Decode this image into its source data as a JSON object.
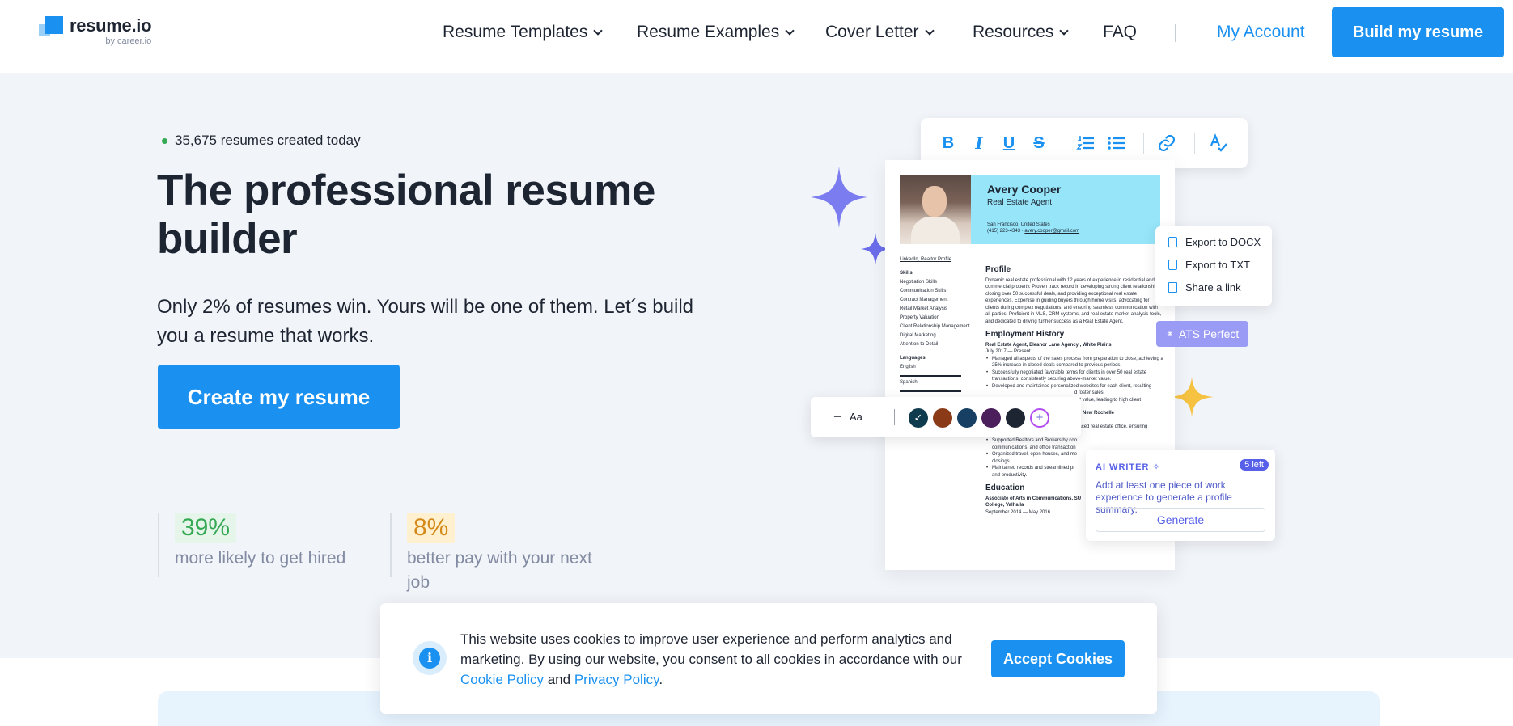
{
  "header": {
    "logo_name": "resume.io",
    "logo_sub": "by career.io",
    "nav": [
      {
        "label": "Resume Templates",
        "has_dropdown": true
      },
      {
        "label": "Resume Examples",
        "has_dropdown": true
      },
      {
        "label": "Cover Letter",
        "has_dropdown": true
      },
      {
        "label": "Resources",
        "has_dropdown": true
      },
      {
        "label": "FAQ",
        "has_dropdown": false
      }
    ],
    "my_account": "My Account",
    "build_button": "Build my resume"
  },
  "hero": {
    "counter": "35,675 resumes created today",
    "title": "The professional resume builder",
    "subtitle": "Only 2% of resumes win. Yours will be one of them. Let´s build you a resume that works.",
    "cta": "Create my resume",
    "stats": [
      {
        "value": "39%",
        "label": "more likely to get hired",
        "color": "#34a853",
        "bg": "#e6f5ea"
      },
      {
        "value": "8%",
        "label": "better pay with your next job",
        "color": "#d48a1a",
        "bg": "#fff1cf"
      }
    ]
  },
  "editor": {
    "toolbar_icons": [
      "bold-icon",
      "italic-icon",
      "underline-icon",
      "strikethrough-icon",
      "numbered-list-icon",
      "bulleted-list-icon",
      "link-icon",
      "spellcheck-icon"
    ],
    "toolbar_glyphs": {
      "bold": "B",
      "italic": "I",
      "underline": "U",
      "strike": "S"
    },
    "resume": {
      "name": "Avery Cooper",
      "role": "Real Estate Agent",
      "location": "San Francisco, United States",
      "phone": "(415) 223-4343",
      "email": "avery.cooper@gmail.com",
      "links": "LinkedIn, Realtor Profile",
      "skills_heading": "Skills",
      "skills": [
        "Negotiation Skills",
        "Communication Skills",
        "Contract Management",
        "Retail Market Analysis",
        "Property Valuation",
        "Client Relationship Management",
        "Digital Marketing",
        "Attention to Detail"
      ],
      "languages_heading": "Languages",
      "languages": [
        "English",
        "Spanish"
      ],
      "profile_heading": "Profile",
      "profile_text": "Dynamic real estate professional with 12 years of experience in residential and commercial property. Proven track record in developing strong client relationships, closing over 50 successful deals, and providing exceptional real estate experiences. Expertise in guiding buyers through home visits, advocating for clients during complex negotiations, and ensuring seamless communication with all parties. Proficient in MLS, CRM systems, and real estate market analysis tools, and dedicated to driving further success as a Real Estate Agent.",
      "employment_heading": "Employment History",
      "job1_title": "Real Estate Agent, Eleanor Lane Agency , White Plains",
      "job1_dates": "July 2017 — Present",
      "job1_bullets": [
        "Managed all aspects of the sales process from preparation to close, achieving a 25% increase in closed deals compared to previous periods.",
        "Successfully negotiated favorable terms for clients in over 50 real estate transactions, consistently securing above-market value.",
        "Developed and maintained personalized websites for each client, resulting",
        "d foster sales.",
        "ket value, leading to high client"
      ],
      "job2_title": "es, New Rochelle",
      "job2_dates": "October 2012 — June 2017",
      "job2_bullets": [
        "Managed administrative tasks in a fast-paced real estate office, ensuring smooth daily operations.",
        "Supported Realtors and Brokers by coo",
        "communications, and office transaction",
        "Organized travel, open houses, and me",
        "closings.",
        "Maintained records and streamlined pr",
        "and productivity."
      ],
      "education_heading": "Education",
      "education_title": "Associate of Arts in Communications, SU College, Valhalla",
      "education_dates": "September 2014 — May 2016"
    },
    "export_menu": [
      "Export to DOCX",
      "Export to TXT",
      "Share a link"
    ],
    "ats_badge": "ATS Perfect",
    "font_control": {
      "minus": "−",
      "label": "Aa"
    },
    "swatches": [
      "#0f3b4f",
      "#8a3a17",
      "#163f63",
      "#4a1f5c",
      "#1e2532"
    ],
    "ai_writer": {
      "title": "AI WRITER",
      "badge": "5 left",
      "text": "Add at least one piece of work experience to generate a profile summary.",
      "button": "Generate"
    }
  },
  "cookie": {
    "text_before": "This website uses cookies to improve user experience and perform analytics and marketing. By using our website, you consent to all cookies in accordance with our ",
    "cookie_policy": "Cookie Policy",
    "and": " and ",
    "privacy_policy": "Privacy Policy",
    "period": ".",
    "accept": "Accept Cookies"
  }
}
